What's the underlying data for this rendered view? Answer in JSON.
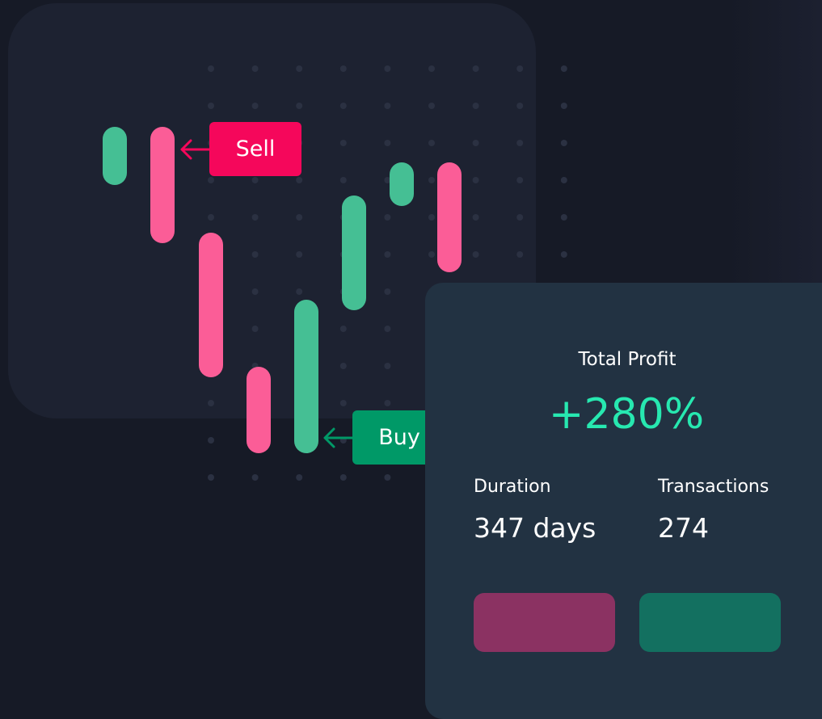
{
  "tags": {
    "sell": "Sell",
    "buy": "Buy"
  },
  "stats": {
    "title": "Total Profit",
    "profit": "+280%",
    "duration_label": "Duration",
    "duration_value": "347 days",
    "transactions_label": "Transactions",
    "transactions_value": "274"
  },
  "colors": {
    "up": "#45bf94",
    "down": "#fb5d97",
    "sell": "#f5075b",
    "buy": "#009967",
    "profit": "#27e8b0",
    "sell_button": "#8b3262",
    "buy_button": "#137060"
  },
  "candles": [
    {
      "direction": "up"
    },
    {
      "direction": "down"
    },
    {
      "direction": "down"
    },
    {
      "direction": "down"
    },
    {
      "direction": "up"
    },
    {
      "direction": "up"
    },
    {
      "direction": "up"
    },
    {
      "direction": "down"
    }
  ]
}
